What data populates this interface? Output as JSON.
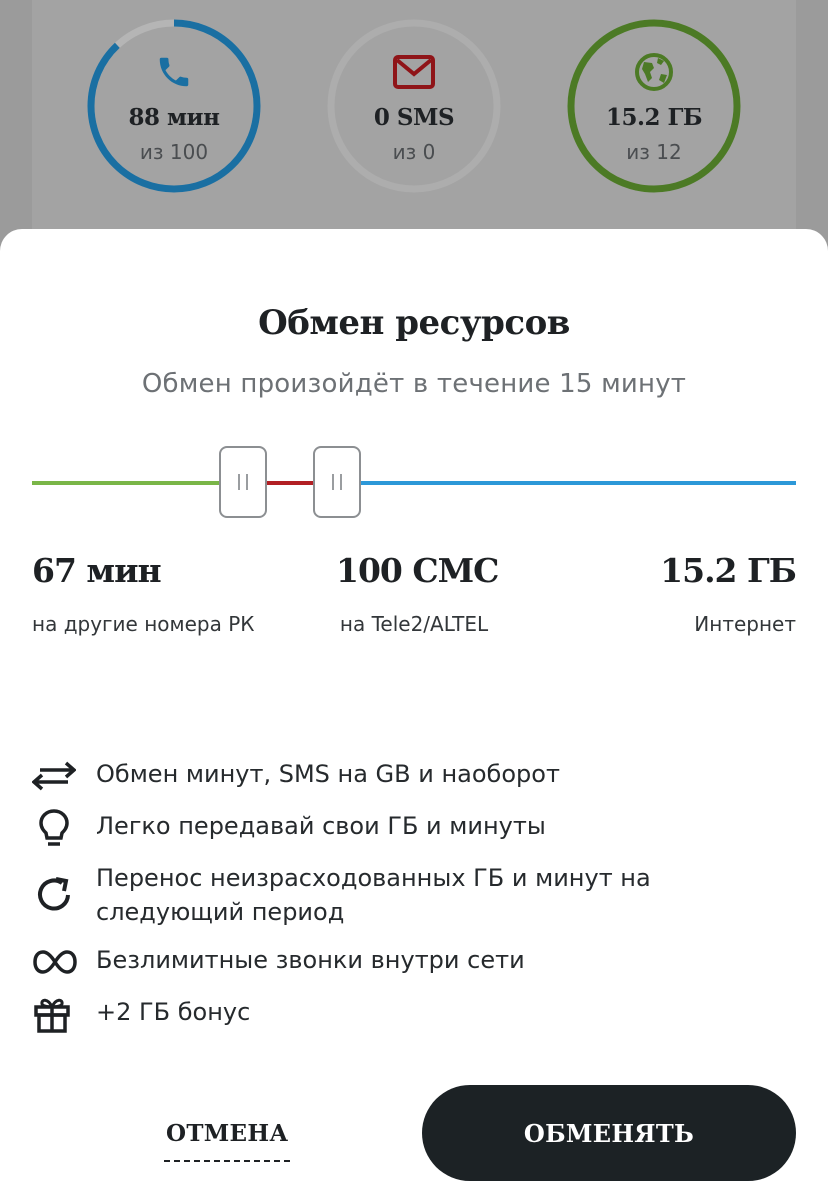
{
  "usage": [
    {
      "value": "88 мин",
      "of": "из 100",
      "color": "#1a6fa2",
      "fraction": 0.88,
      "icon": "phone-icon"
    },
    {
      "value": "0 SMS",
      "of": "из 0",
      "color": "#8f1418",
      "fraction": 0,
      "icon": "envelope-icon"
    },
    {
      "value": "15.2 ГБ",
      "of": "из 12",
      "color": "#4c7a25",
      "fraction": 1,
      "icon": "globe-icon"
    }
  ],
  "sheet": {
    "title": "Обмен ресурсов",
    "subtitle": "Обмен произойдёт в течение 15 минут"
  },
  "resources": {
    "minutes": {
      "value": "67 мин",
      "label": "на другие номера РК"
    },
    "sms": {
      "value": "100 СМС",
      "label": "на Tele2/ALTEL"
    },
    "internet": {
      "value": "15.2 ГБ",
      "label": "Интернет"
    }
  },
  "colors": {
    "minutes_track": "#7ab648",
    "sms_track": "#b21f24",
    "internet_track": "#2c98d8"
  },
  "features": [
    {
      "icon": "swap-arrows-icon",
      "text": "Обмен минут, SMS на GB и наоборот"
    },
    {
      "icon": "lightbulb-icon",
      "text": "Легко передавай свои ГБ и минуты"
    },
    {
      "icon": "refresh-icon",
      "text": "Перенос неизрасходованных ГБ и минут на следующий период"
    },
    {
      "icon": "infinity-icon",
      "text": "Безлимитные звонки внутри сети"
    },
    {
      "icon": "gift-icon",
      "text": "+2 ГБ бонус"
    }
  ],
  "buttons": {
    "cancel": "ОТМЕНА",
    "exchange": "ОБМЕНЯТЬ"
  }
}
